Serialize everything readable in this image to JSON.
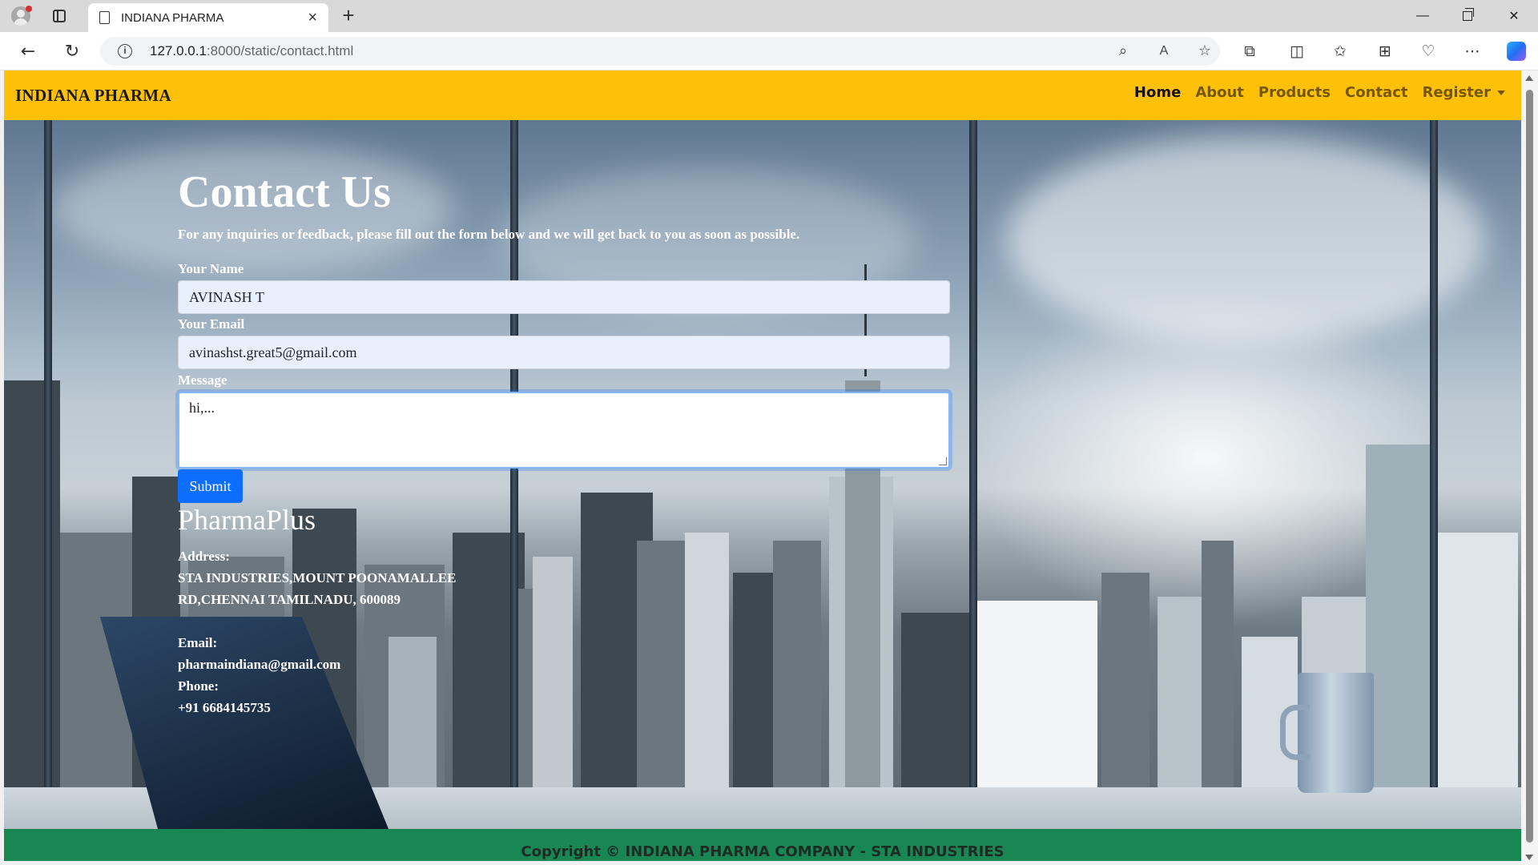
{
  "browser": {
    "tab_title": "INDIANA PHARMA",
    "tab_close": "×",
    "new_tab": "+",
    "url_host": "127.0.0.1",
    "url_rest": ":8000/static/contact.html",
    "window": {
      "minimize": "—",
      "close": "✕"
    }
  },
  "navbar": {
    "brand": "INDIANA PHARMA",
    "links": [
      "Home",
      "About",
      "Products",
      "Contact",
      "Register"
    ],
    "active": "Home",
    "bg_color": "#ffc107"
  },
  "contact": {
    "title": "Contact Us",
    "intro": "For any inquiries or feedback, please fill out the form below and we will get back to you as soon as possible.",
    "name_label": "Your Name",
    "name_value": "AVINASH T",
    "email_label": "Your Email",
    "email_value": "avinashst.great5@gmail.com",
    "message_label": "Message",
    "message_value": "hi,...",
    "submit_label": "Submit"
  },
  "company": {
    "name": "PharmaPlus",
    "address_label": "Address:",
    "address_line1": "STA INDUSTRIES,MOUNT POONAMALLEE",
    "address_line2": "RD,CHENNAI TAMILNADU, 600089",
    "email_label": "Email:",
    "email": "pharmaindiana@gmail.com",
    "phone_label": "Phone:",
    "phone": "+91 6684145735"
  },
  "footer": {
    "text": "Copyright © INDIANA PHARMA COMPANY - STA INDUSTRIES",
    "bg_color": "#198754"
  }
}
